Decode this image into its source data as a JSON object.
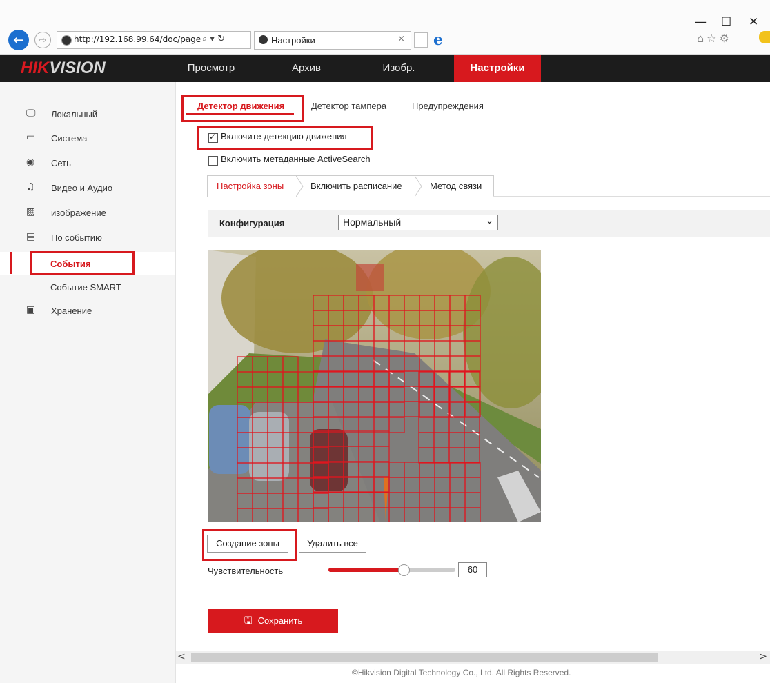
{
  "browser": {
    "url": "http://192.168.99.64/doc/page",
    "tab_title": "Настройки",
    "tab_close": "×",
    "back_glyph": "←",
    "forward_glyph": "⇨",
    "addr_actions": "⌕ ▾ ↻",
    "window_controls": [
      "—",
      "☐",
      "✕"
    ],
    "toolbar_icons": "⌂☆⚙"
  },
  "header": {
    "logo_hik": "HIK",
    "logo_vision": "VISION",
    "nav": [
      "Просмотр",
      "Архив",
      "Изобр.",
      "Настройки"
    ],
    "active": "Настройки"
  },
  "sidebar": {
    "items": [
      {
        "label": "Локальный",
        "icon": "monitor-icon",
        "glyph": "🖵"
      },
      {
        "label": "Система",
        "icon": "window-icon",
        "glyph": "▭"
      },
      {
        "label": "Сеть",
        "icon": "globe-icon",
        "glyph": "◉"
      },
      {
        "label": "Видео и Аудио",
        "icon": "mic-icon",
        "glyph": "♫"
      },
      {
        "label": "изображение",
        "icon": "image-icon",
        "glyph": "▨"
      },
      {
        "label": "По событию",
        "icon": "calendar-icon",
        "glyph": "▤"
      },
      {
        "label": "События",
        "sub": true,
        "active": true
      },
      {
        "label": "Событие SMART",
        "sub": true
      },
      {
        "label": "Хранение",
        "icon": "save-icon",
        "glyph": "▣"
      }
    ]
  },
  "tabs": [
    "Детектор движения",
    "Детектор тампера",
    "Предупреждения"
  ],
  "active_tab": "Детектор движения",
  "checkboxes": {
    "enable_motion": {
      "label": "Включите детекцию движения",
      "checked": true
    },
    "enable_metadata": {
      "label": "Включить метаданные ActiveSearch",
      "checked": false
    }
  },
  "subtabs": [
    "Настройка зоны",
    "Включить расписание",
    "Метод связи"
  ],
  "active_subtab": "Настройка зоны",
  "config": {
    "label": "Конфигурация",
    "value": "Нормальный",
    "arrow": "⌄"
  },
  "buttons": {
    "create_zone": "Создание зоны",
    "delete_all": "Удалить все",
    "save": "Сохранить"
  },
  "sensitivity": {
    "label": "Чувствительность",
    "value": "60"
  },
  "scroll": {
    "left": "<",
    "right": ">"
  },
  "footer": "©Hikvision Digital Technology Co., Ltd. All Rights Reserved.",
  "colors": {
    "accent": "#d7191e",
    "header_bg": "#1c1c1c"
  }
}
